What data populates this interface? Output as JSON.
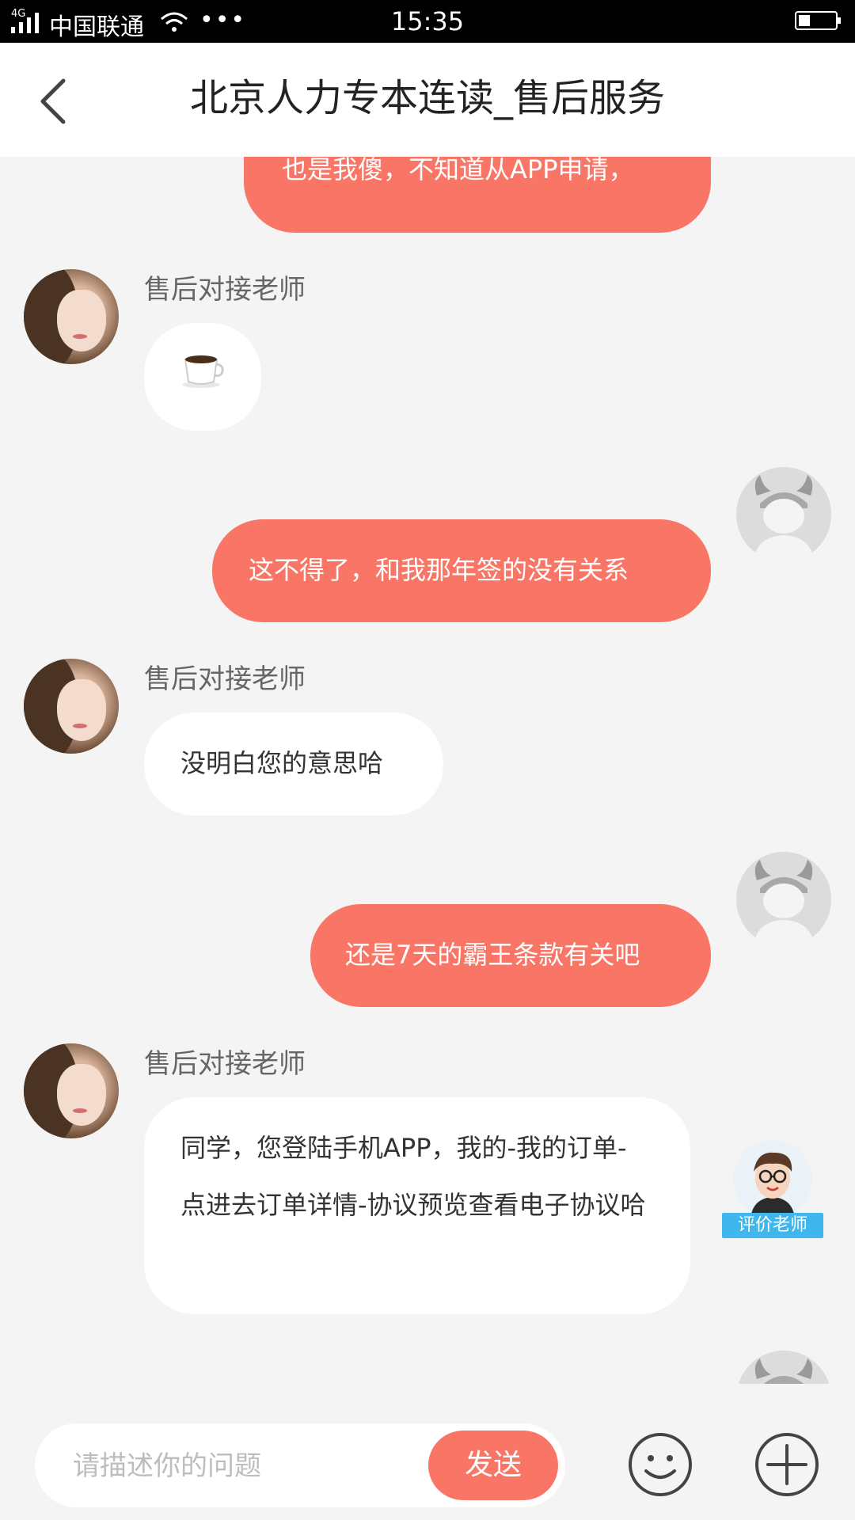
{
  "status_bar": {
    "network": "4G",
    "carrier": "中国联通",
    "time": "15:35"
  },
  "header": {
    "title": "北京人力专本连读_售后服务"
  },
  "messages": [
    {
      "direction": "out",
      "text": "也是我傻，不知道从APP申请，"
    },
    {
      "direction": "in",
      "sender": "售后对接老师",
      "type": "emoji",
      "emoji": "coffee-cup"
    },
    {
      "direction": "out",
      "text": "这不得了，和我那年签的没有关系"
    },
    {
      "direction": "in",
      "sender": "售后对接老师",
      "text": "没明白您的意思哈"
    },
    {
      "direction": "out",
      "text": "还是7天的霸王条款有关吧"
    },
    {
      "direction": "in",
      "sender": "售后对接老师",
      "text": "同学，您登陆手机APP，我的-我的订单-点进去订单详情-协议预览查看电子协议哈"
    }
  ],
  "rate_teacher": {
    "label": "评价老师"
  },
  "input_bar": {
    "placeholder": "请描述你的问题",
    "value": "",
    "send_label": "发送"
  },
  "colors": {
    "accent": "#f97565",
    "background": "#f4f4f4",
    "badge": "#3fb6ec"
  }
}
